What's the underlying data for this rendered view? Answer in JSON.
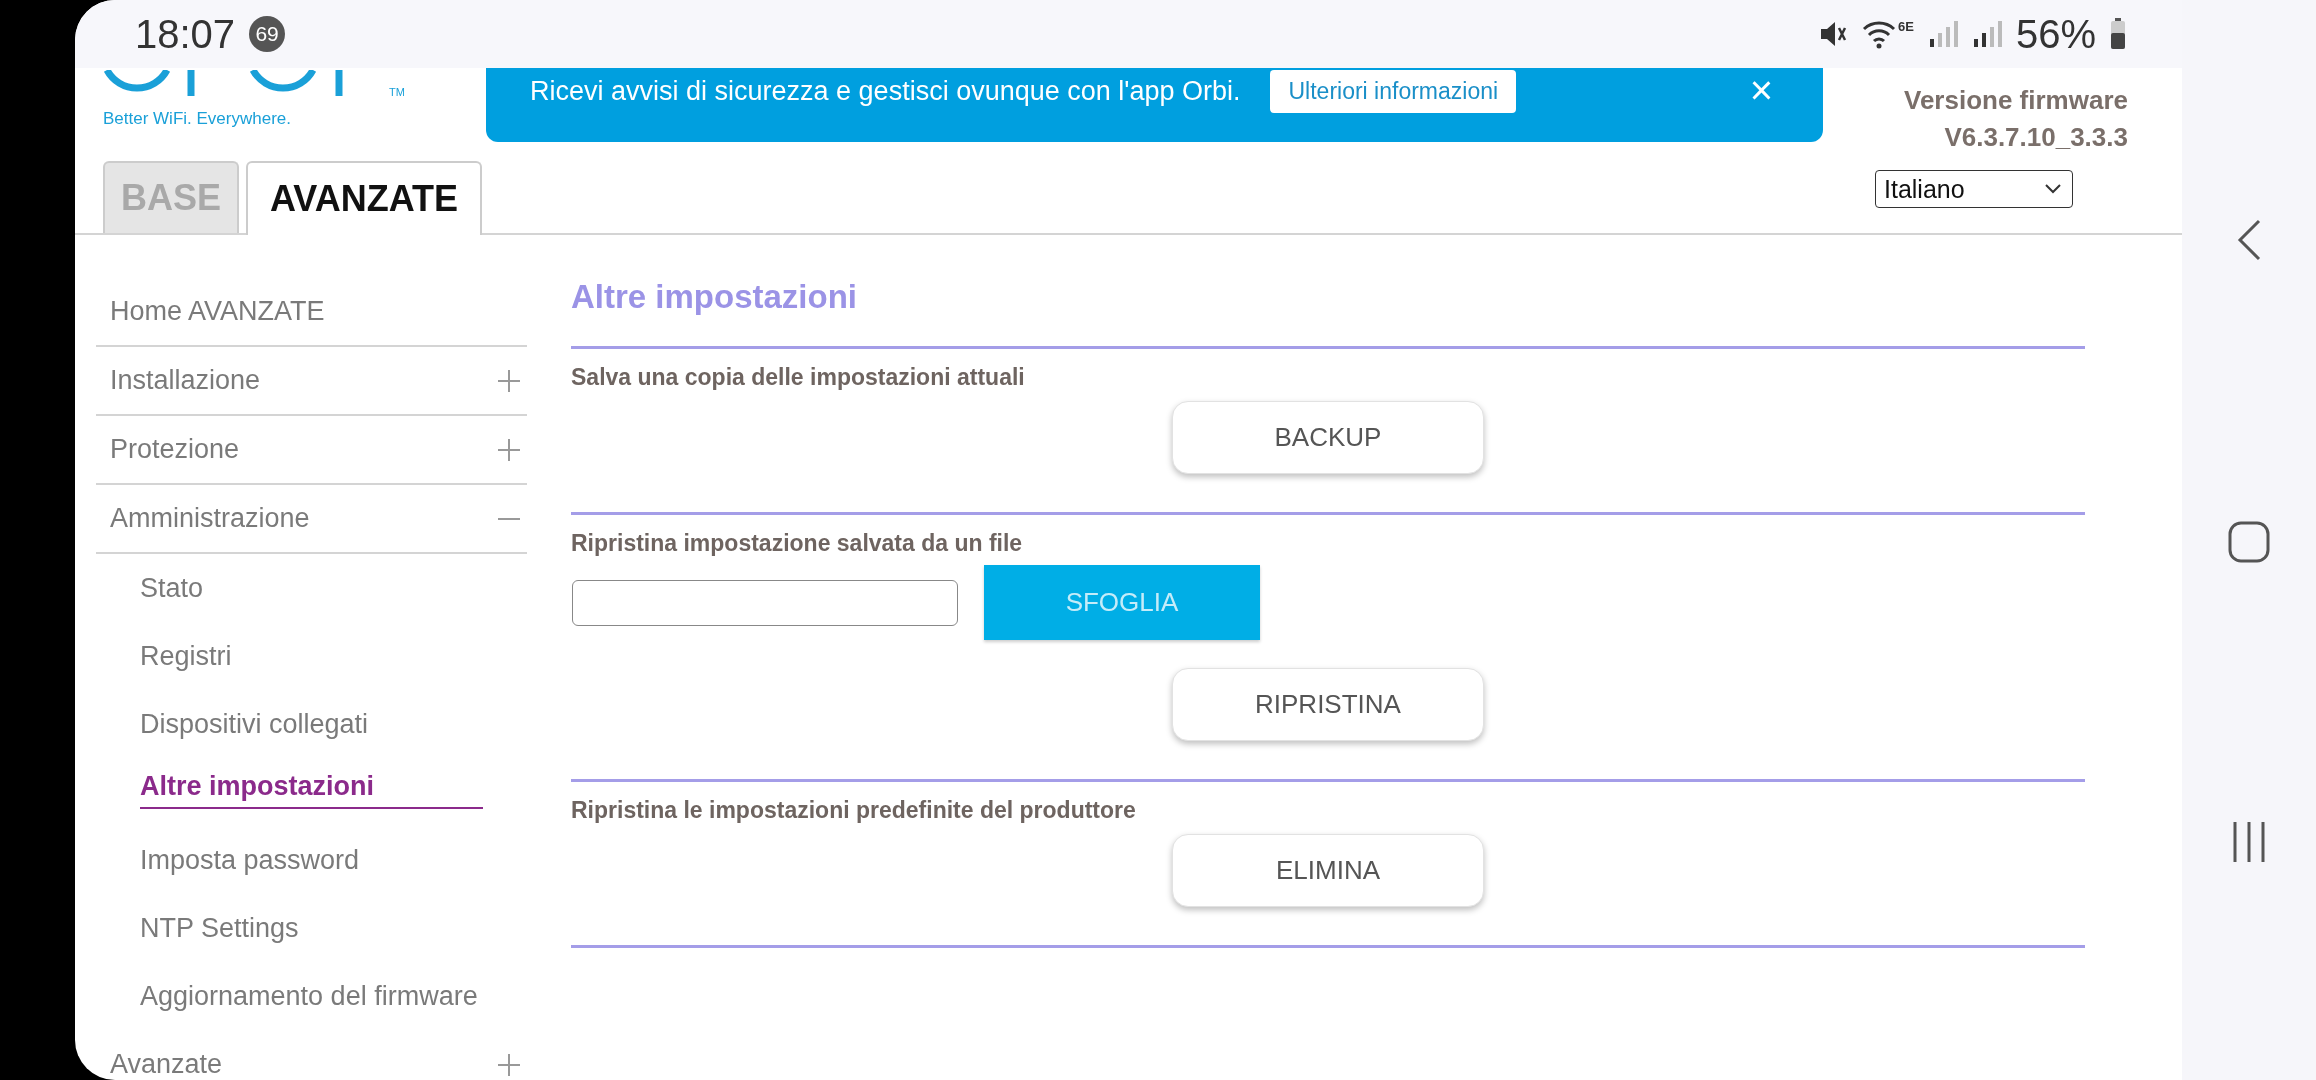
{
  "status_bar": {
    "time": "18:07",
    "notification_count": "69",
    "wifi_label": "6E",
    "battery": "56%"
  },
  "header": {
    "logo_mark": "TM",
    "tagline": "Better WiFi. Everywhere.",
    "banner": {
      "message": "Ricevi avvisi di sicurezza e gestisci ovunque con l'app Orbi.",
      "button": "Ulteriori informazioni",
      "close": "×"
    },
    "firmware_label": "Versione firmware",
    "firmware_version": "V6.3.7.10_3.3.3",
    "language": "Italiano"
  },
  "tabs": [
    {
      "label": "BASE",
      "selected": false
    },
    {
      "label": "AVANZATE",
      "selected": true
    }
  ],
  "sidebar": {
    "items": [
      {
        "label": "Home AVANZATE",
        "kind": "link"
      },
      {
        "label": "Installazione",
        "kind": "group",
        "expanded": false
      },
      {
        "label": "Protezione",
        "kind": "group",
        "expanded": false
      },
      {
        "label": "Amministrazione",
        "kind": "group",
        "expanded": true,
        "children": [
          {
            "label": "Stato",
            "selected": false
          },
          {
            "label": "Registri",
            "selected": false
          },
          {
            "label": "Dispositivi collegati",
            "selected": false
          },
          {
            "label": "Altre impostazioni",
            "selected": true
          },
          {
            "label": "Imposta password",
            "selected": false
          },
          {
            "label": "NTP Settings",
            "selected": false
          },
          {
            "label": "Aggiornamento del firmware",
            "selected": false
          }
        ]
      },
      {
        "label": "Avanzate",
        "kind": "group",
        "expanded": false
      }
    ]
  },
  "page": {
    "title": "Altre impostazioni",
    "sections": [
      {
        "kind": "button",
        "label": "Salva una copia delle impostazioni attuali",
        "button": "BACKUP"
      },
      {
        "kind": "file",
        "label": "Ripristina impostazione salvata da un file",
        "browse_button": "SFOGLIA",
        "button": "RIPRISTINA"
      },
      {
        "kind": "button",
        "label": "Ripristina le impostazioni predefinite del produttore",
        "button": "ELIMINA"
      }
    ]
  }
}
